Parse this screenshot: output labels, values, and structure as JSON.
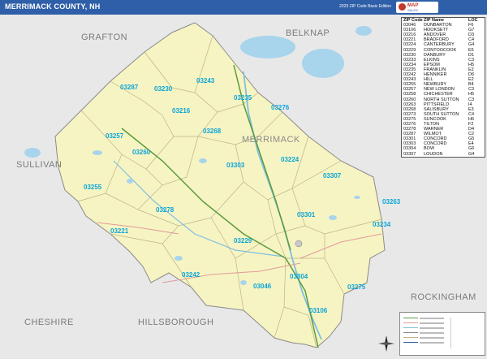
{
  "header": {
    "title": "MERRIMACK COUNTY, NH",
    "subtitle": "2023 ZIP Code Basic Edition",
    "logo_name": "logo-icon"
  },
  "counties": [
    {
      "id": "grafton",
      "name": "GRAFTON"
    },
    {
      "id": "belknap",
      "name": "BELKNAP"
    },
    {
      "id": "merrimack",
      "name": "MERRIMACK"
    },
    {
      "id": "sullivan",
      "name": "SULLIVAN"
    },
    {
      "id": "cheshire",
      "name": "CHESHIRE"
    },
    {
      "id": "hillsborough",
      "name": "HILLSBOROUGH"
    },
    {
      "id": "rockingham",
      "name": "ROCKINGHAM"
    }
  ],
  "zip_labels": [
    "03287",
    "03230",
    "03243",
    "03235",
    "03216",
    "03276",
    "03268",
    "03257",
    "03260",
    "03224",
    "03303",
    "03307",
    "03255",
    "03278",
    "03301",
    "03263",
    "03221",
    "03234",
    "03229",
    "03242",
    "03046",
    "03304",
    "03275",
    "03106"
  ],
  "zip_index": {
    "headers": [
      "ZIP Code",
      "ZIP Name",
      "LOC"
    ],
    "rows": [
      [
        "03046",
        "DUNBARTON",
        "F6"
      ],
      [
        "03106",
        "HOOKSETT",
        "G7"
      ],
      [
        "03216",
        "ANDOVER",
        "D3"
      ],
      [
        "03221",
        "BRADFORD",
        "C4"
      ],
      [
        "03224",
        "CANTERBURY",
        "G4"
      ],
      [
        "03229",
        "CONTOOCOOK",
        "E5"
      ],
      [
        "03230",
        "DANBURY",
        "D1"
      ],
      [
        "03233",
        "ELKINS",
        "C3"
      ],
      [
        "03234",
        "EPSOM",
        "H5"
      ],
      [
        "03235",
        "FRANKLIN",
        "E2"
      ],
      [
        "03242",
        "HENNIKER",
        "D6"
      ],
      [
        "03243",
        "HILL",
        "E2"
      ],
      [
        "03255",
        "NEWBURY",
        "B4"
      ],
      [
        "03257",
        "NEW LONDON",
        "C3"
      ],
      [
        "03258",
        "CHICHESTER",
        "H5"
      ],
      [
        "03260",
        "NORTH SUTTON",
        "C3"
      ],
      [
        "03263",
        "PITTSFIELD",
        "I4"
      ],
      [
        "03268",
        "SALISBURY",
        "E3"
      ],
      [
        "03273",
        "SOUTH SUTTON",
        "C4"
      ],
      [
        "03275",
        "SUNCOOK",
        "H6"
      ],
      [
        "03276",
        "TILTON",
        "F2"
      ],
      [
        "03278",
        "WARNER",
        "D4"
      ],
      [
        "03287",
        "WILMOT",
        "C2"
      ],
      [
        "03301",
        "CONCORD",
        "G5"
      ],
      [
        "03303",
        "CONCORD",
        "E4"
      ],
      [
        "03304",
        "BOW",
        "G6"
      ],
      [
        "03307",
        "LOUDON",
        "G4"
      ]
    ]
  },
  "legend": {
    "name": "map-legend"
  },
  "compass": {
    "name": "north-arrow-icon"
  },
  "colors": {
    "header": "#2f5fa8",
    "county_fill": "#f7f4c3",
    "zip_label": "#0aa5d8",
    "water": "#a8d4ec",
    "outside": "#e6e6e6"
  }
}
